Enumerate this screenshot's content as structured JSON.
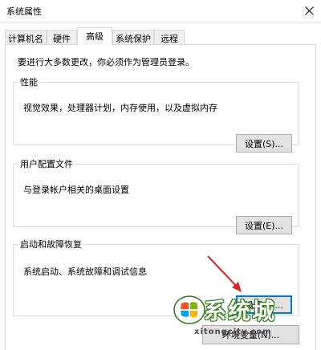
{
  "window": {
    "title": "系统属性",
    "close_icon": "close-icon"
  },
  "tabs": [
    {
      "label": "计算机名",
      "active": false
    },
    {
      "label": "硬件",
      "active": false
    },
    {
      "label": "高级",
      "active": true
    },
    {
      "label": "系统保护",
      "active": false
    },
    {
      "label": "远程",
      "active": false
    }
  ],
  "admin_note": "要进行大多数更改，你必须作为管理员登录。",
  "performance": {
    "title": "性能",
    "description": "视觉效果，处理器计划，内存使用，以及虚拟内存",
    "button": "设置(S)..."
  },
  "user_profiles": {
    "title": "用户配置文件",
    "description": "与登录帐户相关的桌面设置",
    "button": "设置(E)..."
  },
  "startup_recovery": {
    "title": "启动和故障恢复",
    "description": "系统启动、系统故障和调试信息",
    "button": "设置(T)..."
  },
  "env_button": "环境变量(N)...",
  "watermark": {
    "brand": "系统城",
    "url": "xitongcity.com"
  },
  "colors": {
    "accent": "#0078d7",
    "arrow": "#d9262a",
    "watermark_green": "#2c7a16"
  }
}
